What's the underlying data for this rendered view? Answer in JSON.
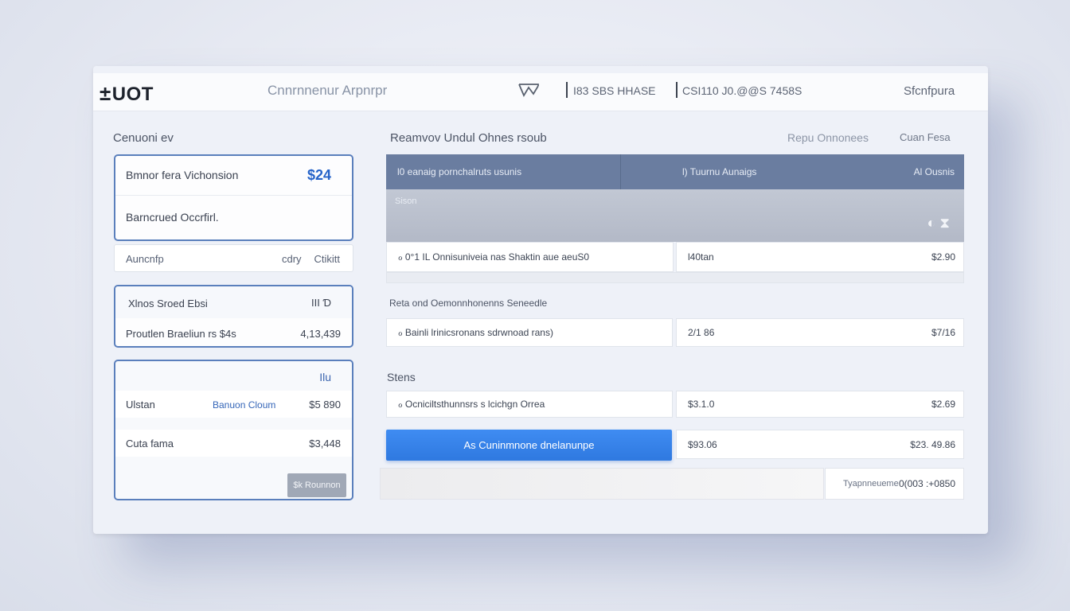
{
  "header": {
    "logo": "UOT",
    "logo_mark": "±",
    "app_title": "Cnnrnnenur Arpnrpr",
    "stat_1": "I83 SBS HHASE",
    "stat_2": "CSI110 J0.@@S 7458S",
    "user": "Sfcnfpura"
  },
  "left_column": {
    "title": "Cenuoni ev",
    "card_1": {
      "row_1_label": "Bmnor fera Vichonsion",
      "row_1_value": "$24",
      "row_2_label": "Barncrued Occrfirl."
    },
    "plain_row": {
      "label": "Auncnfp",
      "value_1": "cdry",
      "value_2": "Ctikitt"
    },
    "card_2": {
      "header_label": "Xlnos Sroed Ebsi",
      "header_value": "III Ɗ",
      "row_label": "Proutlen Braeliun rs $4s",
      "row_value": "4,13,439"
    },
    "card_3": {
      "top_value": "Ilu",
      "row_1_label": "Ulstan",
      "row_1_mid": "Banuon Cloum",
      "row_1_value": "$5 890",
      "row_2_label": "Cuta fama",
      "row_2_value": "$3,448",
      "button": "$k Rounnon"
    }
  },
  "right_column": {
    "title": "Reamvov Undul Ohnes rsoub",
    "link_1": "Repu Onnonees",
    "link_2": "Cuan Fesa",
    "table_header": {
      "col_1": "l0 eanaig pornchalruts usunis",
      "col_2": "l) Tuurnu Aunaigs",
      "col_3": "Al Ousnis"
    },
    "table_sub_label": "Sison",
    "table_sub_icons": "◐ ⧗",
    "row_1": {
      "label": "ℴ 0°1 IL Onnisuniveia nas Shaktin aue aeuS0",
      "mid": "l40tan",
      "value": "$2.90"
    },
    "section_2_title": "Reta ond Oemonnhonenns Seneedle",
    "row_2": {
      "label": "ℴ Bainli lrinicsronans sdrwnoad rans)",
      "mid": "2/1 86",
      "value": "$7/16"
    },
    "section_3_title": "Stens",
    "row_3": {
      "label": "ℴ Ocniciltsthunnsrs s lcichgn Orrea",
      "mid": "$3.1.0",
      "value": "$2.69"
    },
    "primary_button": "As Cuninmnone dnelanunpe",
    "row_4": {
      "mid": "$93.06",
      "value": "$23. 49.86"
    },
    "total": {
      "label": "Tyapnneueme",
      "value": "0(003 :+0850"
    }
  }
}
